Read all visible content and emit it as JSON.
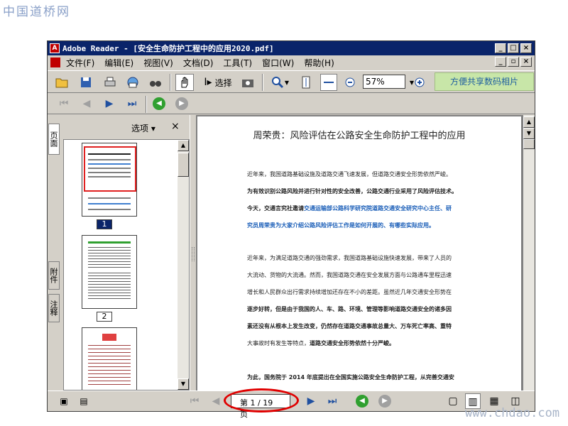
{
  "watermark": {
    "top": "中国道桥网",
    "bottom": "www.chdao.com"
  },
  "window": {
    "title": "Adobe Reader - [安全生命防护工程中的应用2020.pdf]",
    "controls": [
      "_",
      "□",
      "×"
    ]
  },
  "menu": [
    "文件(F)",
    "编辑(E)",
    "视图(V)",
    "文档(D)",
    "工具(T)",
    "窗口(W)",
    "帮助(H)"
  ],
  "toolbar": {
    "select_label": "选择",
    "zoom_value": "57%",
    "share_label": "方便共享数码相片"
  },
  "pane": {
    "tabs": [
      "页面",
      "附件",
      "注释"
    ],
    "options_label": "选项 ▾",
    "close_label": "×",
    "pages": [
      "1",
      "2"
    ]
  },
  "document": {
    "title": "周荣贵：风险评估在公路安全生命防护工程中的应用",
    "p1_l1": "近年来，我国道路基础设施及道路交通飞速发展，但道路交通安全形势依然严峻。",
    "p1_l2": "为有效识别公路风险并进行针对性的安全改善，公路交通行业采用了风险评估技术。",
    "p1_l3_a": "今天，交通言究社邀请",
    "p1_l3_b": "交通运输部公路科学研究院道路交通安全研究中心主任、研",
    "p1_l4": "究员周荣贵为大家介绍公路风险评估工作是如何开展的、有哪些实际应用。",
    "p2_l1": "近年来，为满足道路交通的强劲需求，我国道路基础设施快速发展，带来了人员的",
    "p2_l2": "大流动、货物的大流通。然而，我国道路交通在安全发展方面与公路通车里程迅速",
    "p2_l3": "增长和人民群众出行需求持续增加还存在不小的差距。虽然近几年交通安全形势在",
    "p2_l4": "逐步好转，但是由于我国的人、车、路、环境、管理等影响道路交通安全的诸多因",
    "p2_l5": "素还没有从根本上发生改变，仍然存在道路交通事故总量大、万车死亡率高、重特",
    "p2_l6_a": "大事故时有发生等特点，",
    "p2_l6_b": "道路交通安全形势依然十分严峻。",
    "p3_l1": "为此，国务院于 2014 年底提出在全国实施公路安全生命防护工程，从完善交通安"
  },
  "status": {
    "page_indicator": "第 1 / 19 页"
  }
}
